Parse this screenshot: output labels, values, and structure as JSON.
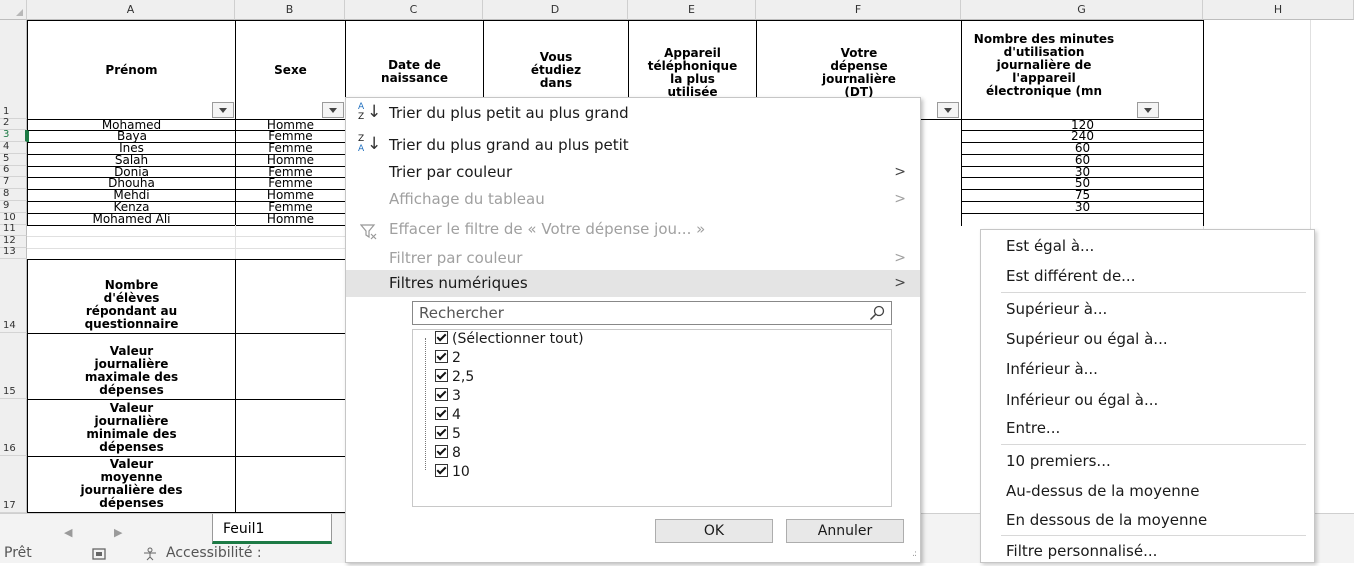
{
  "grid": {
    "columns": [
      "A",
      "B",
      "C",
      "D",
      "E",
      "F",
      "G",
      "H"
    ],
    "rows": [
      "1",
      "2",
      "3",
      "4",
      "5",
      "6",
      "7",
      "8",
      "9",
      "10",
      "11",
      "12",
      "13",
      "14",
      "15",
      "16",
      "17"
    ],
    "headers": {
      "prenom": "Prénom",
      "sexe": "Sexe",
      "date": [
        "Date de",
        "naissance"
      ],
      "etudiez": [
        "Vous",
        "étudiez",
        "dans"
      ],
      "appareil": [
        "Appareil",
        "téléphonique",
        "la plus",
        "utilisée"
      ],
      "depense": [
        "Votre",
        "dépense",
        "journalière",
        "(DT)"
      ],
      "minutes": [
        "Nombre des minutes",
        "d'utilisation",
        "journalière de",
        "l'appareil",
        "électronique (mn"
      ]
    },
    "data_rows": [
      {
        "prenom": "Mohamed",
        "sexe": "Homme",
        "minutes": "120"
      },
      {
        "prenom": "Baya",
        "sexe": "Femme",
        "minutes": "240"
      },
      {
        "prenom": "Ines",
        "sexe": "Femme",
        "minutes": "60"
      },
      {
        "prenom": "Salah",
        "sexe": "Homme",
        "minutes": "60"
      },
      {
        "prenom": "Donia",
        "sexe": "Femme",
        "minutes": "30"
      },
      {
        "prenom": "Dhouha",
        "sexe": "Femme",
        "minutes": "50"
      },
      {
        "prenom": "Mehdi",
        "sexe": "Homme",
        "minutes": "75"
      },
      {
        "prenom": "Kenza",
        "sexe": "Femme",
        "minutes": "30"
      },
      {
        "prenom": "Mohamed Ali",
        "sexe": "Homme",
        "minutes": ""
      }
    ],
    "summary_labels": [
      [
        "Nombre",
        "d'élèves",
        "répondant au",
        "questionnaire"
      ],
      [
        "Valeur",
        "journalière",
        "maximale des",
        "dépenses"
      ],
      [
        "Valeur",
        "journalière",
        "minimale des",
        "dépenses"
      ],
      [
        "Valeur",
        "moyenne",
        "journalière des",
        "dépenses"
      ]
    ]
  },
  "sheet_tab": "Feuil1",
  "status": {
    "ready": "Prêt",
    "accessibility": "Accessibilité :"
  },
  "filter_menu": {
    "sort_asc": "Trier du plus petit au plus grand",
    "sort_desc": "Trier du plus grand au plus petit",
    "sort_color": "Trier par couleur",
    "table_view": "Affichage du tableau",
    "clear_filter": "Effacer le filtre de « Votre dépense jou... »",
    "filter_color": "Filtrer par couleur",
    "number_filters": "Filtres numériques",
    "search_placeholder": "Rechercher",
    "values": [
      "(Sélectionner tout)",
      "2",
      "2,5",
      "3",
      "4",
      "5",
      "8",
      "10"
    ],
    "ok": "OK",
    "cancel": "Annuler"
  },
  "number_filter_submenu": [
    "Est égal à...",
    "Est différent de...",
    "Supérieur à...",
    "Supérieur ou égal à...",
    "Inférieur à...",
    "Inférieur ou égal à...",
    "Entre...",
    "10 premiers...",
    "Au-dessus de la moyenne",
    "En dessous de la moyenne",
    "Filtre personnalisé..."
  ],
  "colors": {
    "excel_green": "#1d7a45",
    "header_gray": "#efefef",
    "highlight": "#e4e4e4"
  }
}
